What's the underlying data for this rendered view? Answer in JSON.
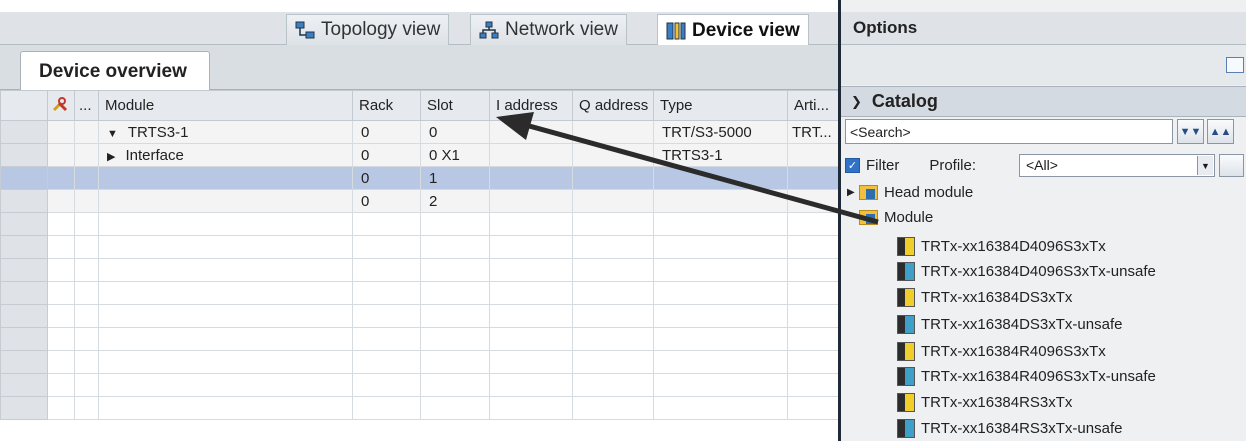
{
  "view_tabs": [
    {
      "label": "Topology view",
      "icon": "topology-icon",
      "active": false
    },
    {
      "label": "Network view",
      "icon": "network-icon",
      "active": false
    },
    {
      "label": "Device view",
      "icon": "device-icon",
      "active": true
    }
  ],
  "device_overview": {
    "tab_label": "Device overview",
    "columns": [
      "",
      "...",
      "Module",
      "Rack",
      "Slot",
      "I address",
      "Q address",
      "Type",
      "Arti..."
    ],
    "rows": [
      {
        "module": "TRTS3-1",
        "expander": "expanded",
        "rack": "0",
        "slot": "0",
        "i_address": "",
        "q_address": "",
        "type": "TRT/S3-5000",
        "article": "TRT..."
      },
      {
        "module": "Interface",
        "expander": "collapsed",
        "rack": "0",
        "slot": "0 X1",
        "i_address": "",
        "q_address": "",
        "type": "TRTS3-1",
        "article": ""
      },
      {
        "module": "",
        "expander": "",
        "rack": "0",
        "slot": "1",
        "i_address": "",
        "q_address": "",
        "type": "",
        "article": "",
        "selected": true
      },
      {
        "module": "",
        "expander": "",
        "rack": "0",
        "slot": "2",
        "i_address": "",
        "q_address": "",
        "type": "",
        "article": ""
      }
    ]
  },
  "options": {
    "title": "Options",
    "catalog_title": "Catalog",
    "search_placeholder": "<Search>",
    "filter_label": "Filter",
    "filter_checked": true,
    "profile_label": "Profile:",
    "profile_value": "<All>",
    "tree": [
      {
        "label": "Head module",
        "kind": "folder",
        "expander": "collapsed"
      },
      {
        "label": "Module",
        "kind": "folder",
        "expander": "expanded"
      },
      {
        "label": "TRTx-xx16384D4096S3xTx",
        "kind": "module-yellow"
      },
      {
        "label": "TRTx-xx16384D4096S3xTx-unsafe",
        "kind": "module-blue"
      },
      {
        "label": "TRTx-xx16384DS3xTx",
        "kind": "module-yellow"
      },
      {
        "label": "TRTx-xx16384DS3xTx-unsafe",
        "kind": "module-blue"
      },
      {
        "label": "TRTx-xx16384R4096S3xTx",
        "kind": "module-yellow"
      },
      {
        "label": "TRTx-xx16384R4096S3xTx-unsafe",
        "kind": "module-blue"
      },
      {
        "label": "TRTx-xx16384RS3xTx",
        "kind": "module-yellow"
      },
      {
        "label": "TRTx-xx16384RS3xTx-unsafe",
        "kind": "module-blue"
      }
    ]
  },
  "colors": {
    "selection": "#b8c8e4",
    "divider": "#1f2a38",
    "arrow": "#2b2b2b"
  }
}
